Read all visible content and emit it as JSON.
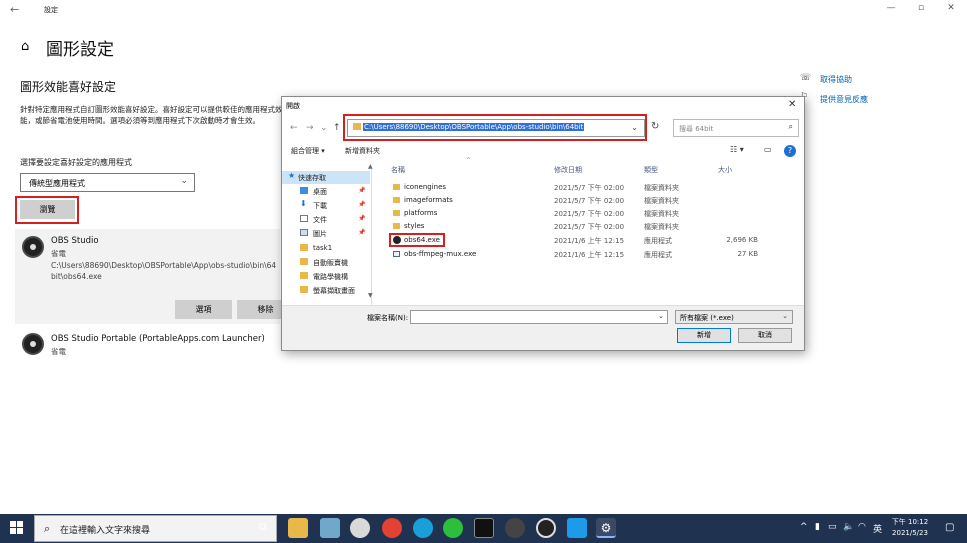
{
  "settings": {
    "window_title": "設定",
    "page_title": "圖形設定",
    "section_title": "圖形效能喜好設定",
    "description": "針對特定應用程式自訂圖形效能喜好設定。喜好設定可以提供較佳的應用程式效能，或節省電池使用時間。選項必須等到應用程式下次啟動時才會生效。",
    "choose_label": "選擇要設定喜好設定的應用程式",
    "app_type_dropdown": "傳統型應用程式",
    "browse_button": "瀏覽",
    "apps": [
      {
        "name": "OBS Studio",
        "preference": "省電",
        "path": "C:\\Users\\88690\\Desktop\\OBSPortable\\App\\obs-studio\\bin\\64bit\\obs64.exe",
        "options_button": "選項",
        "remove_button": "移除"
      },
      {
        "name": "OBS Studio Portable (PortableApps.com Launcher)",
        "preference": "省電"
      }
    ],
    "help_links": {
      "get_help": "取得協助",
      "feedback": "提供意見反應"
    }
  },
  "dialog": {
    "title": "開啟",
    "address": "C:\\Users\\88690\\Desktop\\OBSPortable\\App\\obs-studio\\bin\\64bit",
    "search_placeholder": "搜尋 64bit",
    "toolbar": {
      "organize": "組合管理 ▾",
      "new_folder": "新增資料夾"
    },
    "nav_items": [
      {
        "label": "快速存取",
        "pinned": false
      },
      {
        "label": "桌面",
        "pinned": true
      },
      {
        "label": "下載",
        "pinned": true
      },
      {
        "label": "文件",
        "pinned": true
      },
      {
        "label": "圖片",
        "pinned": true
      },
      {
        "label": "task1",
        "pinned": false
      },
      {
        "label": "自動販賣機",
        "pinned": false
      },
      {
        "label": "電路學機構",
        "pinned": false
      },
      {
        "label": "螢幕擷取畫面",
        "pinned": false
      }
    ],
    "columns": {
      "name": "名稱",
      "date": "修改日期",
      "type": "類型",
      "size": "大小"
    },
    "files": [
      {
        "name": "iconengines",
        "date": "2021/5/7 下午 02:00",
        "type": "檔案資料夾",
        "size": "",
        "kind": "folder"
      },
      {
        "name": "imageformats",
        "date": "2021/5/7 下午 02:00",
        "type": "檔案資料夾",
        "size": "",
        "kind": "folder"
      },
      {
        "name": "platforms",
        "date": "2021/5/7 下午 02:00",
        "type": "檔案資料夾",
        "size": "",
        "kind": "folder"
      },
      {
        "name": "styles",
        "date": "2021/5/7 下午 02:00",
        "type": "檔案資料夾",
        "size": "",
        "kind": "folder"
      },
      {
        "name": "obs64.exe",
        "date": "2021/1/6 上午 12:15",
        "type": "應用程式",
        "size": "2,696 KB",
        "kind": "obs"
      },
      {
        "name": "obs-ffmpeg-mux.exe",
        "date": "2021/1/6 上午 12:15",
        "type": "應用程式",
        "size": "27 KB",
        "kind": "exe"
      }
    ],
    "filename_label": "檔案名稱(N):",
    "filename_value": "",
    "filetype": "所有檔案 (*.exe)",
    "open_button": "新增",
    "cancel_button": "取消"
  },
  "taskbar": {
    "search_placeholder": "在這裡輸入文字來搜尋",
    "ime": "英",
    "time": "下午 10:12",
    "date": "2021/5/23"
  },
  "colors": {
    "accent": "#0078d7",
    "highlight_box": "#d62020",
    "taskbar": "#1f3250"
  }
}
